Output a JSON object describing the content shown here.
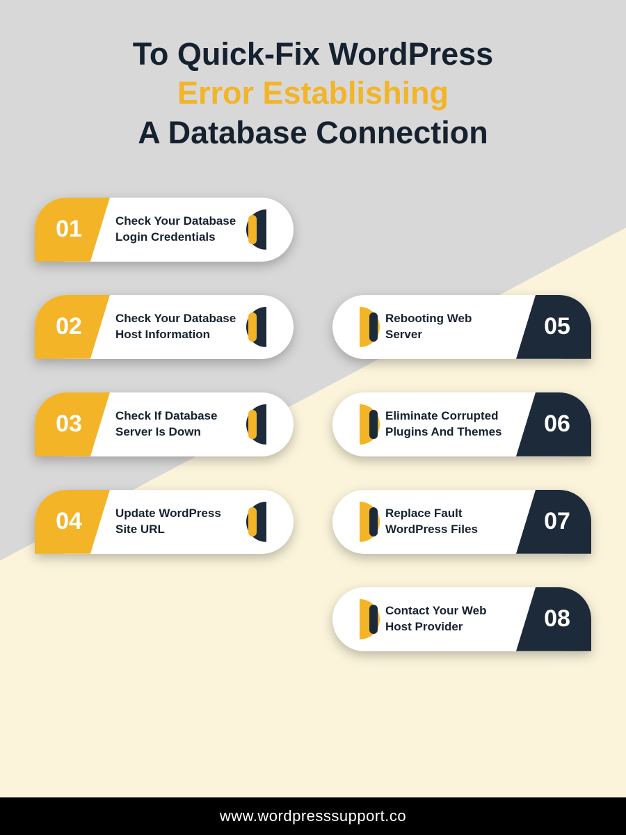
{
  "title": {
    "line1": "To Quick-Fix WordPress",
    "line2": "Error Establishing",
    "line3": "A Database Connection"
  },
  "steps": {
    "s1": {
      "num": "01",
      "text": "Check Your Database Login Credentials"
    },
    "s2": {
      "num": "02",
      "text": "Check Your Database Host Information"
    },
    "s3": {
      "num": "03",
      "text": "Check If Database Server Is Down"
    },
    "s4": {
      "num": "04",
      "text": "Update WordPress Site URL"
    },
    "s5": {
      "num": "05",
      "text": "Rebooting Web Server"
    },
    "s6": {
      "num": "06",
      "text": "Eliminate Corrupted Plugins And Themes"
    },
    "s7": {
      "num": "07",
      "text": "Replace Fault WordPress Files"
    },
    "s8": {
      "num": "08",
      "text": "Contact Your Web Host Provider"
    }
  },
  "footer": "www.wordpresssupport.co",
  "colors": {
    "accent": "#f3b428",
    "dark": "#1d2a3a",
    "bg1": "#d8d8d8",
    "bg2": "#fbf4db"
  }
}
